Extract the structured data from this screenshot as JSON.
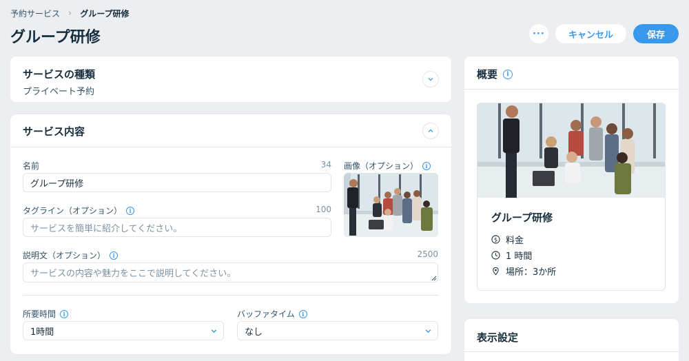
{
  "breadcrumb": {
    "parent": "予約サービス",
    "current": "グループ研修"
  },
  "page_title": "グループ研修",
  "actions": {
    "more_label": "···",
    "cancel_label": "キャンセル",
    "save_label": "保存"
  },
  "service_type": {
    "title": "サービスの種類",
    "value": "プライベート予約"
  },
  "service_details": {
    "title": "サービス内容",
    "name": {
      "label": "名前",
      "counter": "34",
      "value": "グループ研修"
    },
    "tagline": {
      "label": "タグライン（オプション）",
      "counter": "100",
      "placeholder": "サービスを簡単に紹介してください。"
    },
    "image": {
      "label": "画像（オプション）"
    },
    "description": {
      "label": "説明文（オプション）",
      "counter": "2500",
      "placeholder": "サービスの内容や魅力をここで説明してください。"
    },
    "duration": {
      "label": "所要時間",
      "value": "1時間"
    },
    "buffer": {
      "label": "バッファタイム",
      "value": "なし"
    }
  },
  "summary": {
    "title": "概要",
    "service_name": "グループ研修",
    "price_label": "料金",
    "duration_label": "1 時間",
    "location_label": "場所：3か所"
  },
  "display_settings": {
    "title": "表示設定"
  },
  "colors": {
    "accent": "#3899ec",
    "background": "#eceef2",
    "text": "#162d3d"
  }
}
